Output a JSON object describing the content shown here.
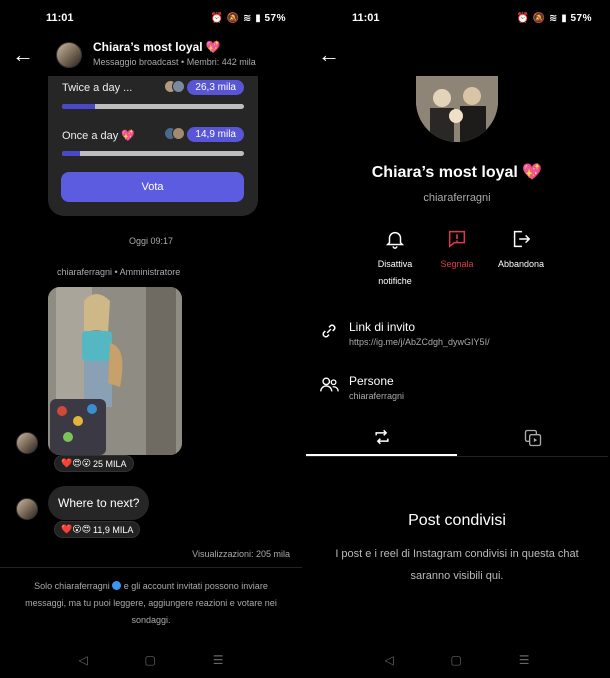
{
  "status_bar": {
    "time": "11:01",
    "battery": "57%"
  },
  "left": {
    "header": {
      "title": "Chiara’s most loyal 💖",
      "subtitle": "Messaggio broadcast • Membri: 442 mila"
    },
    "poll": {
      "options": [
        {
          "label": "Twice a day ...",
          "count": "26,3 mila",
          "fill": 0.18
        },
        {
          "label": "Once a day 💖",
          "count": "14,9 mila",
          "fill": 0.1
        }
      ],
      "vote_label": "Vota"
    },
    "timestamp": "Oggi 09:17",
    "sender": "chiaraferragni • Amministratore",
    "photo_reactions": {
      "emojis": "❤️😍😮",
      "count": "25 MILA"
    },
    "message": {
      "text": "Where to next?",
      "reactions": "❤️😮😍",
      "count": "11,9 MILA"
    },
    "views": "Visualizzazioni: 205 mila",
    "footer": {
      "part1": "Solo chiaraferragni",
      "part2": " e gli account invitati possono inviare messaggi, ma tu puoi leggere, aggiungere reazioni e votare nei sondaggi."
    }
  },
  "right": {
    "title": "Chiara’s most loyal 💖",
    "username": "chiaraferragni",
    "actions": [
      {
        "label": "Disattiva notifiche"
      },
      {
        "label": "Segnala"
      },
      {
        "label": "Abbandona"
      }
    ],
    "invite": {
      "title": "Link di invito",
      "url": "https://ig.me/j/AbZCdgh_dywGIY5I/"
    },
    "people": {
      "title": "Persone",
      "sub": "chiaraferragni"
    },
    "empty": {
      "title": "Post condivisi",
      "text": "I post e i reel di Instagram condivisi in questa chat saranno visibili qui."
    }
  },
  "nav": {
    "back": "◁",
    "home": "▢",
    "menu": "☰"
  }
}
